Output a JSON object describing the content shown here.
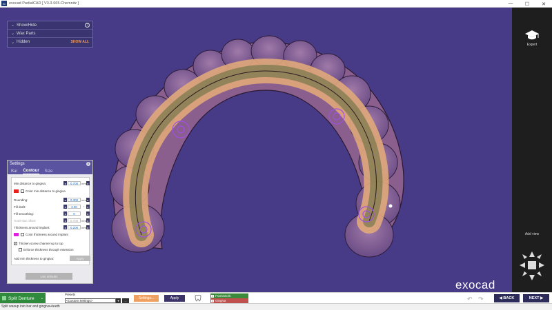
{
  "window": {
    "title": "exocad PartialCAD [ V3.3-665.Chemnitz ]",
    "app_icon_text": "ex",
    "controls": {
      "minimize": "—",
      "maximize": "☐",
      "close": "✕"
    }
  },
  "visibility_panel": {
    "items": [
      {
        "label": "Show/Hide",
        "chevron": "⌄"
      },
      {
        "label": "Wax Parts",
        "chevron": "⌄"
      },
      {
        "label": "Hidden",
        "chevron": "⌄",
        "action": "SHOW ALL"
      }
    ],
    "help_symbol": "?"
  },
  "settings_panel": {
    "title": "Settings",
    "close_symbol": "x",
    "tabs": [
      {
        "label": "Bar",
        "active": false
      },
      {
        "label": "Contour",
        "active": true
      },
      {
        "label": "Size",
        "active": false
      }
    ],
    "rows": {
      "min_distance": {
        "label": "Min distance to gingiva:",
        "value": "0.700",
        "unit": "mm"
      },
      "color_min_distance": {
        "label": "Color min distance to gingiva",
        "swatch_color": "#e82020"
      },
      "rounding": {
        "label": "Rounding:",
        "value": "0.300",
        "unit": "mm"
      },
      "fill_draft": {
        "label": "Fill draft:",
        "value": "3.00",
        "unit": "°"
      },
      "fill_smoothing": {
        "label": "Fill smoothing:",
        "value": "0",
        "unit": ""
      },
      "tooth_bar_offset": {
        "label": "Tooth-bar offset:",
        "value": "0.700",
        "unit": "mm"
      },
      "thickness_around_implant": {
        "label": "Thickness around implant:",
        "value": "0.200",
        "unit": "mm"
      },
      "color_thickness": {
        "label": "Color thickness around implant",
        "swatch_color": "#e020e0"
      },
      "thicken_screw": {
        "label": "Thicken screw channel up to top",
        "checked": true
      },
      "enforce_thickness": {
        "label": "Enforce thickness through extension",
        "checked": false
      },
      "add_min_thickness": {
        "label": "Add min thickness to gingiva:",
        "button": "Apply"
      }
    },
    "use_defaults": "Use defaults",
    "spin_minus": "◂",
    "spin_plus": "▸"
  },
  "right_panel": {
    "expert_label": "Expert",
    "add_view_label": "Add view"
  },
  "logo": "exocad",
  "bottom_bar": {
    "split_button": "Split Denture",
    "split_chevron": "⌄",
    "presets_label": "Presets",
    "preset_value": "<Custom Settings>",
    "dropdown_symbol": "▾",
    "more_symbol": "...",
    "settings_button": "Settings...",
    "apply_button": "Apply",
    "legend": [
      {
        "label": "Framework",
        "color": "#3c8a3c",
        "checked": true
      },
      {
        "label": "Gingiva",
        "color": "#c0504d",
        "checked": true
      }
    ],
    "undo_symbol": "↶",
    "redo_symbol": "↷",
    "back_button": "◀ BACK",
    "next_button": "NEXT ▶"
  },
  "status_bar": {
    "text": "Split waxup into bar and gingiva+teeth"
  }
}
